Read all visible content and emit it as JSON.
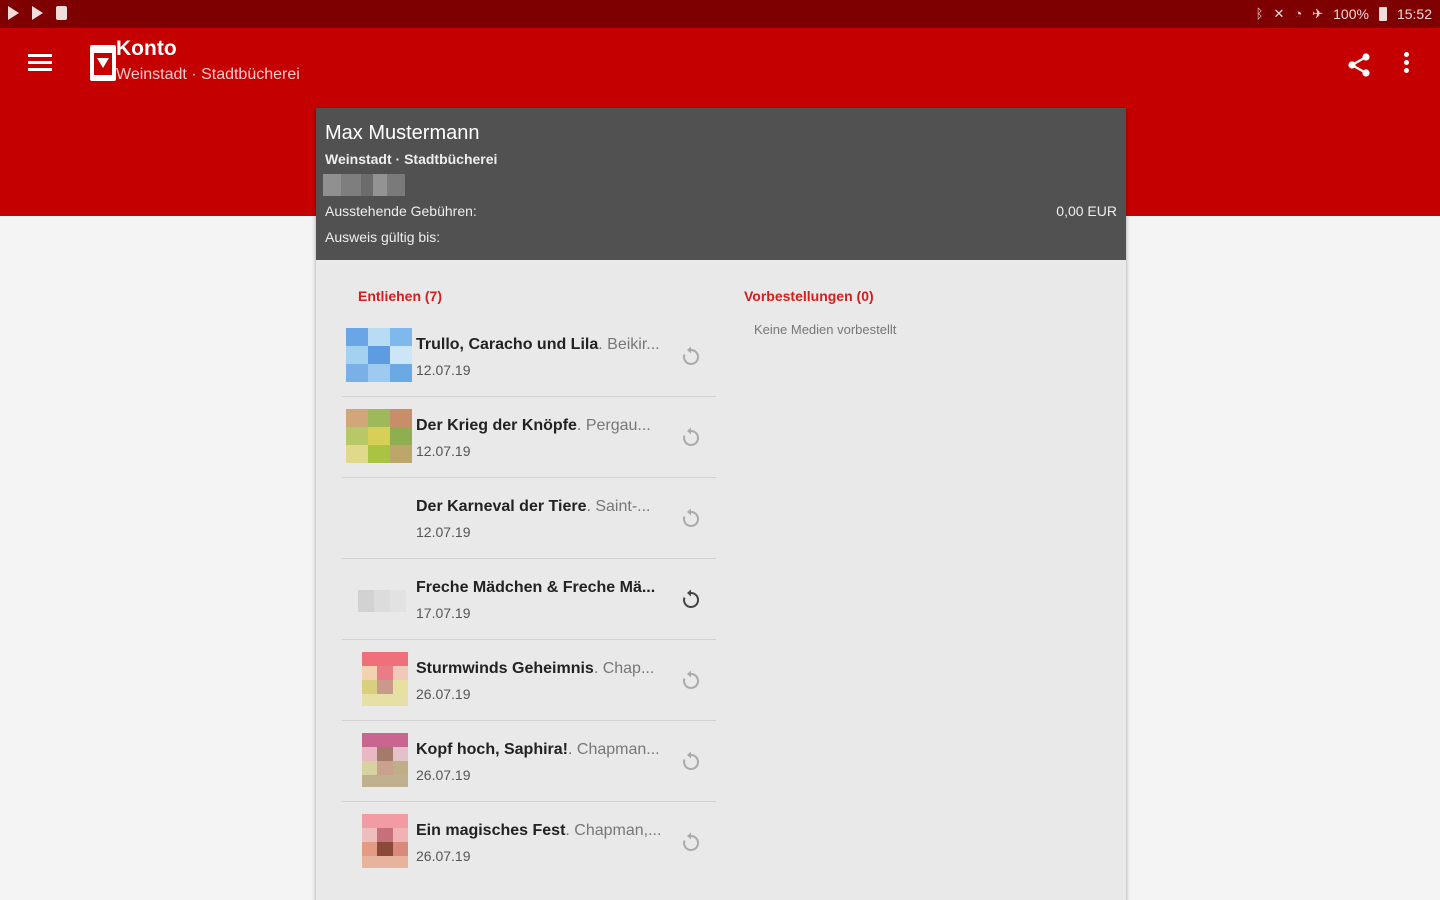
{
  "statusbar": {
    "battery": "100%",
    "time": "15:52",
    "icons_left": [
      "play-store-icon",
      "play-store-icon",
      "sd-card-icon"
    ],
    "icons_right": [
      "bluetooth-icon",
      "mute-icon",
      "wifi-icon",
      "airplane-icon",
      "battery-icon"
    ]
  },
  "appbar": {
    "title": "Konto",
    "subtitle": "Weinstadt · Stadtbücherei",
    "color": "#c50000"
  },
  "account": {
    "name": "Max Mustermann",
    "library": "Weinstadt · Stadtbücherei",
    "fees_label": "Ausstehende Gebühren:",
    "fees_value": "0,00 EUR",
    "valid_label": "Ausweis gültig bis:"
  },
  "lent": {
    "title": "Entliehen (7)",
    "items": [
      {
        "title": "Trullo, Caracho und Lila",
        "author": ". Beikir...",
        "date": "12.07.19"
      },
      {
        "title": "Der Krieg der Knöpfe",
        "author": ". Pergau...",
        "date": "12.07.19"
      },
      {
        "title": "Der Karneval der Tiere",
        "author": ". Saint-...",
        "date": "12.07.19"
      },
      {
        "title": "Freche Mädchen & Freche Mä...",
        "author": "",
        "date": "17.07.19"
      },
      {
        "title": "Sturmwinds Geheimnis",
        "author": ". Chap...",
        "date": "26.07.19"
      },
      {
        "title": "Kopf hoch, Saphira!",
        "author": ". Chapman...",
        "date": "26.07.19"
      },
      {
        "title": "Ein magisches Fest",
        "author": ". Chapman,...",
        "date": "26.07.19"
      }
    ]
  },
  "reservations": {
    "title": "Vorbestellungen (0)",
    "empty_text": "Keine Medien vorbestellt"
  }
}
